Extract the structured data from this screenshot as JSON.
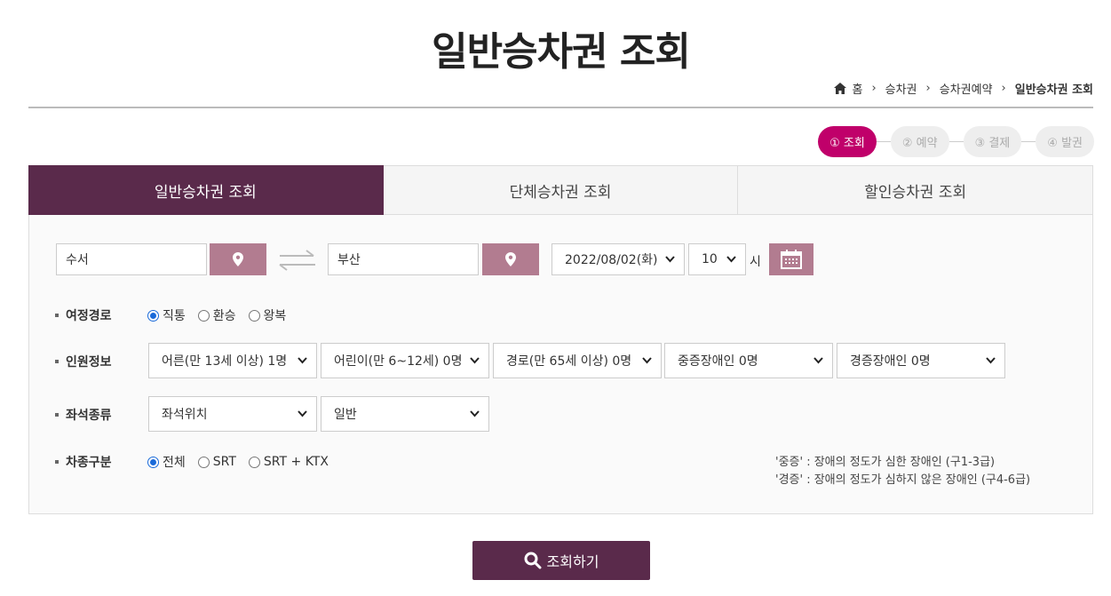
{
  "page": {
    "title": "일반승차권 조회"
  },
  "breadcrumb": {
    "home": "홈",
    "items": [
      "승차권",
      "승차권예약",
      "일반승차권 조회"
    ],
    "home_icon": "home-icon",
    "separator": "›"
  },
  "steps": [
    {
      "label": "① 조회",
      "active": true
    },
    {
      "label": "② 예약",
      "active": false
    },
    {
      "label": "③ 결제",
      "active": false
    },
    {
      "label": "④ 발권",
      "active": false
    }
  ],
  "tabs": [
    {
      "label": "일반승차권 조회",
      "active": true
    },
    {
      "label": "단체승차권 조회",
      "active": false
    },
    {
      "label": "할인승차권 조회",
      "active": false
    }
  ],
  "route": {
    "departure": "수서",
    "arrival": "부산",
    "date": "2022/08/02(화)",
    "hour": "10",
    "hour_unit": "시",
    "pin_icon": "location-pin-icon",
    "swap_icon": "swap-arrows-icon",
    "calendar_icon": "calendar-icon"
  },
  "trip_type": {
    "label": "여정경로",
    "options": [
      "직통",
      "환승",
      "왕복"
    ],
    "selected": "직통"
  },
  "passengers": {
    "label": "인원정보",
    "selects": [
      "어른(만 13세 이상) 1명",
      "어린이(만 6~12세) 0명",
      "경로(만 65세 이상) 0명",
      "중증장애인 0명",
      "경증장애인 0명"
    ]
  },
  "seat": {
    "label": "좌석종류",
    "position": "좌석위치",
    "class": "일반"
  },
  "train_type": {
    "label": "차종구분",
    "options": [
      "전체",
      "SRT",
      "SRT + KTX"
    ],
    "selected": "전체"
  },
  "notes": [
    "'중증' : 장애의 정도가 심한 장애인 (구1-3급)",
    "'경증' : 장애의 정도가 심하지 않은 장애인 (구4-6급)"
  ],
  "search_button": {
    "label": "조회하기",
    "icon": "search-icon"
  },
  "colors": {
    "primary": "#5a2a4b",
    "accent": "#c0006a",
    "pin": "#b27c90",
    "radio": "#1a6ad9"
  }
}
